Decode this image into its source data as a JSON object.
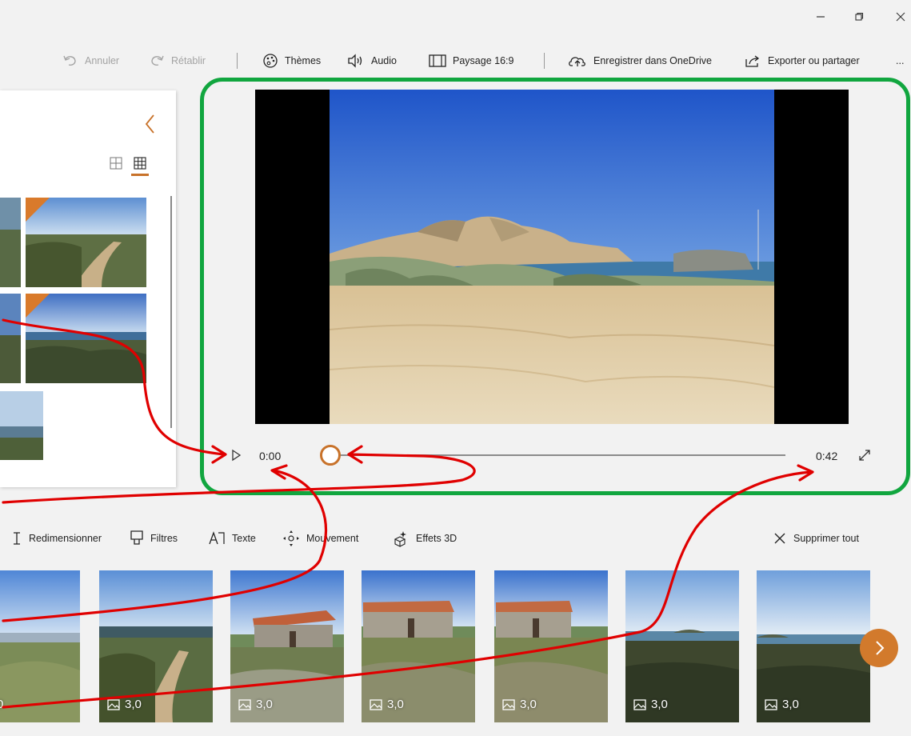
{
  "window": {
    "minimize_icon": "minimize-icon",
    "maximize_icon": "restore-icon",
    "close_icon": "close-icon"
  },
  "toolbar": {
    "undo": "Annuler",
    "redo": "Rétablir",
    "themes": "Thèmes",
    "audio": "Audio",
    "aspect": "Paysage 16:9",
    "save": "Enregistrer dans OneDrive",
    "export": "Exporter ou partager",
    "more": "..."
  },
  "player": {
    "current_time": "0:00",
    "total_time": "0:42",
    "progress": 0.0
  },
  "storyboard_tools": {
    "resize": "Redimensionner",
    "filters": "Filtres",
    "text": "Texte",
    "motion": "Mouvement",
    "effects3d": "Effets 3D",
    "delete_all": "Supprimer tout"
  },
  "storyboard": {
    "first_duration": "0",
    "cards": [
      {
        "duration": "3,0"
      },
      {
        "duration": "3,0"
      },
      {
        "duration": "3,0"
      },
      {
        "duration": "3,0"
      },
      {
        "duration": "3,0"
      },
      {
        "duration": "3,0"
      }
    ]
  },
  "colors": {
    "accent": "#c8722a",
    "highlight_ring": "#11a63f",
    "annotation": "#e00000"
  }
}
